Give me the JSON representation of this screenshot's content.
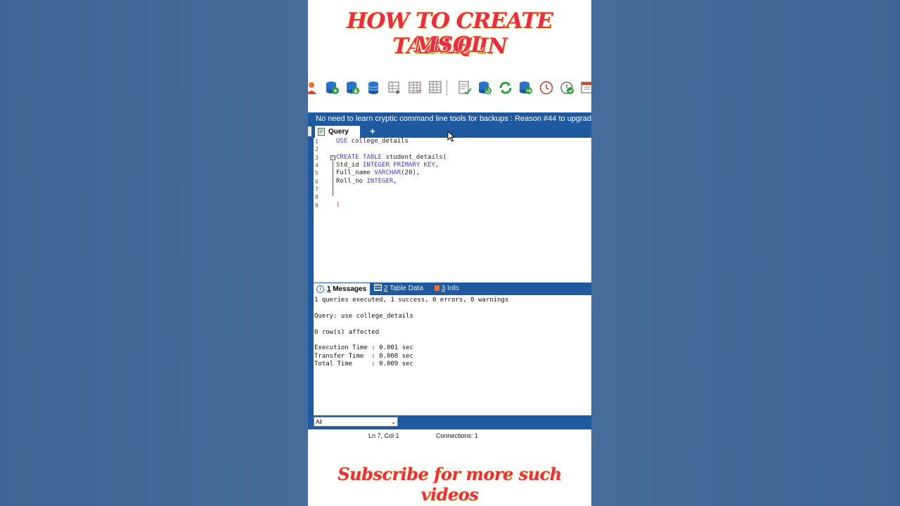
{
  "overlay": {
    "title_line1": "HOW TO CREATE TABLE IN",
    "title_line2": "MSQL",
    "subscribe": "Subscribe for more such videos"
  },
  "toolbar": {
    "icons": [
      "user-icon",
      "db-add-icon",
      "db-import-icon",
      "db-icon",
      "table-export-icon",
      "table-grid-icon",
      "table-alt-icon",
      "edit-doc-icon",
      "db-refresh-icon",
      "refresh-icon",
      "db-sync-icon",
      "clock-icon",
      "schedule-icon",
      "window-icon"
    ]
  },
  "banner": {
    "text": "No need to learn cryptic command line tools for backups : Reason #44 to upgrade"
  },
  "query_tab": {
    "label": "Query",
    "add": "+"
  },
  "editor": {
    "line_numbers": [
      "1",
      "2",
      "3",
      "4",
      "5",
      "6",
      "7",
      "8",
      "9"
    ],
    "line1": {
      "kw": "USE",
      "rest": " college_details"
    },
    "line3": {
      "kw1": "CREATE",
      "sp": " ",
      "kw2": "TABLE",
      "rest": " student_details("
    },
    "line4": {
      "name": "Std_id ",
      "kw": "INTEGER PRIMARY KEY",
      "tail": ","
    },
    "line5": {
      "name": "Full_name ",
      "kw": "VARCHAR",
      "tail": "(20),"
    },
    "line6": {
      "name": "Roll_no ",
      "kw": "INTEGER",
      "tail": ","
    },
    "line9": ")"
  },
  "result_tabs": {
    "messages": {
      "num": "1",
      "label": " Messages"
    },
    "table_data": {
      "num": "2",
      "label": " Table Data"
    },
    "info": {
      "num": "3",
      "label": " Info"
    }
  },
  "messages": {
    "lines": [
      "1 queries executed, 1 success, 0 errors, 0 warnings",
      "Query: use college_details",
      "0 row(s) affected",
      "Execution Time : 0.001 sec",
      "Transfer Time  : 0.008 sec",
      "Total Time     : 0.009 sec"
    ]
  },
  "filter": {
    "selected": "All"
  },
  "status": {
    "position": "Ln 7, Col 1",
    "connections": "Connections: 1"
  },
  "colors": {
    "accent": "#1f5aa0",
    "title": "#e62e4a",
    "background": "#45699a"
  }
}
